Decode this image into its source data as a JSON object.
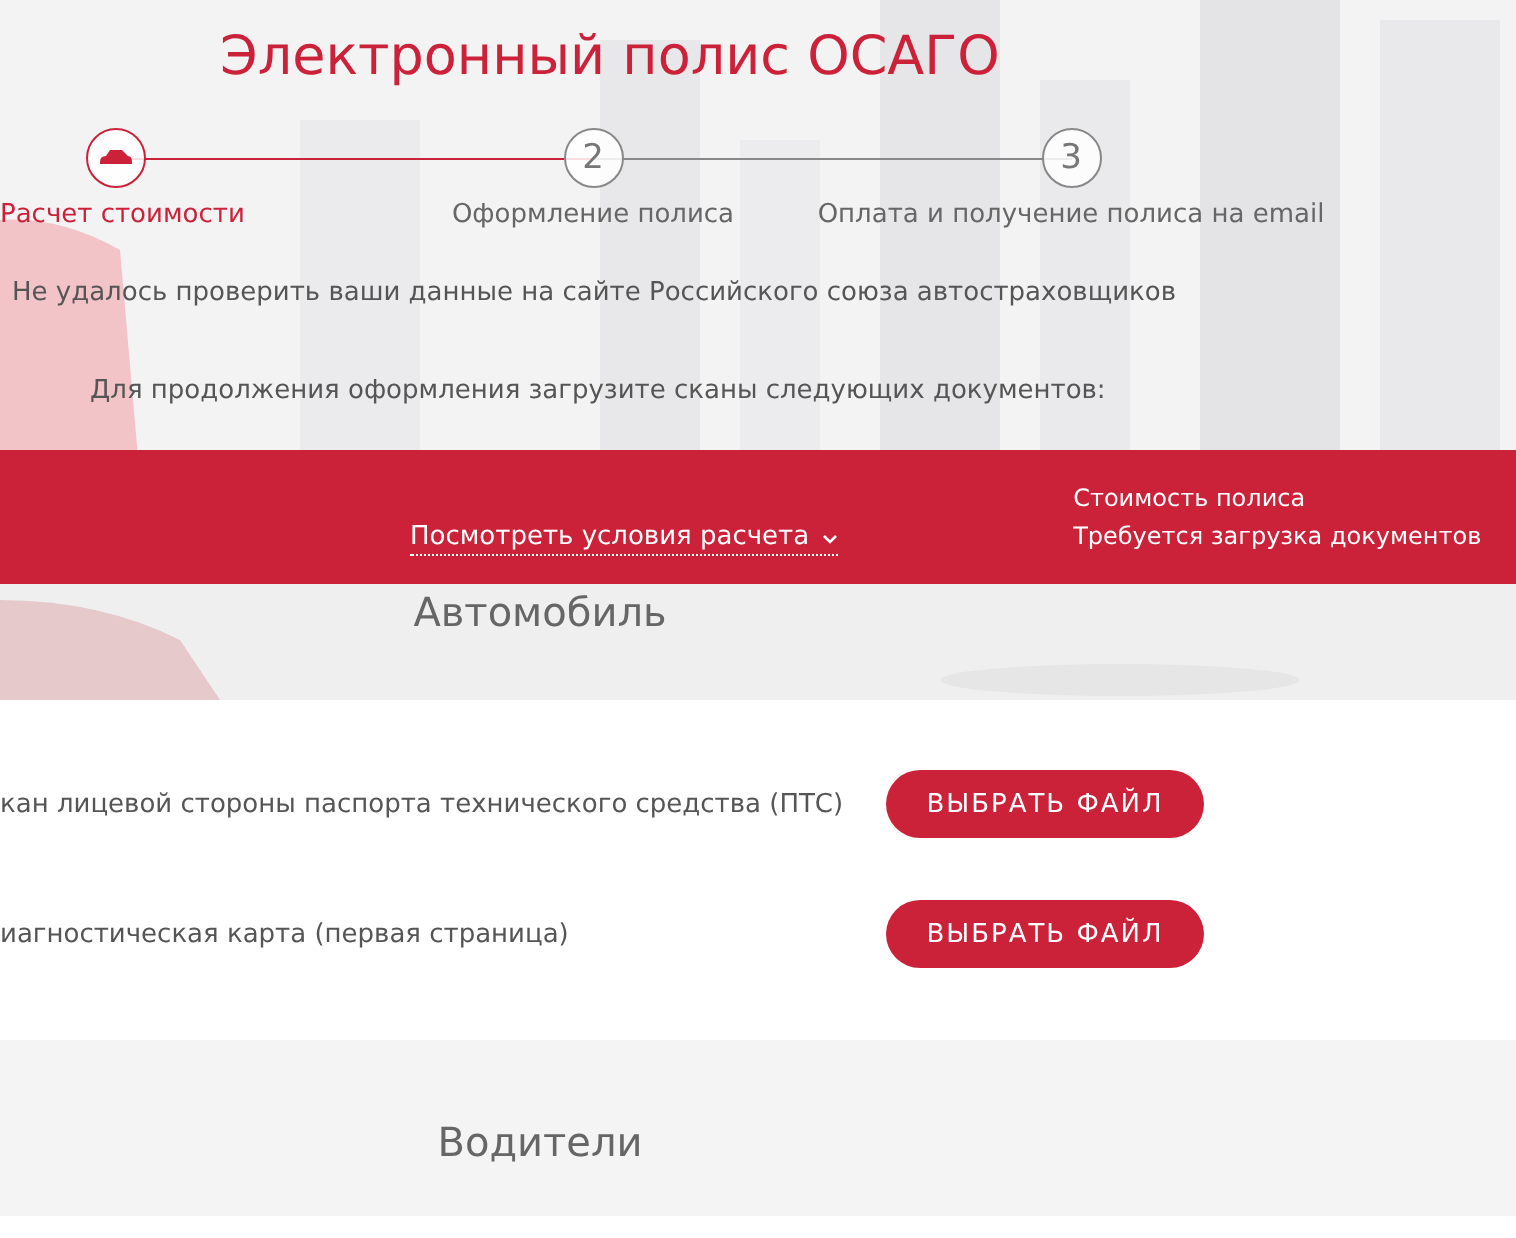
{
  "title": "Электронный полис ОСАГО",
  "steps": [
    {
      "kind": "icon",
      "label": "Расчет стоимости",
      "selected": true
    },
    {
      "kind": "number",
      "number": "2",
      "label": "Оформление полиса",
      "selected": false
    },
    {
      "kind": "number",
      "number": "3",
      "label": "Оплата и получение полиса на email",
      "selected": false
    }
  ],
  "messages": [
    "Не удалось проверить ваши данные на сайте Российского союза автостраховщиков",
    "Для продолжения оформления загрузите сканы следующих документов:"
  ],
  "summary_bar": {
    "link": "Посмотреть условия расчета",
    "price_label": "Стоимость полиса",
    "price_status": "Требуется загрузка документов"
  },
  "sections": [
    {
      "title": "Автомобиль",
      "documents": [
        {
          "label": "кан лицевой стороны паспорта технического средства (ПТС)",
          "button": "ВЫБРАТЬ ФАЙЛ"
        },
        {
          "label": "иагностическая карта (первая страница)",
          "button": "ВЫБРАТЬ ФАЙЛ"
        }
      ]
    },
    {
      "title": "Водители"
    }
  ]
}
